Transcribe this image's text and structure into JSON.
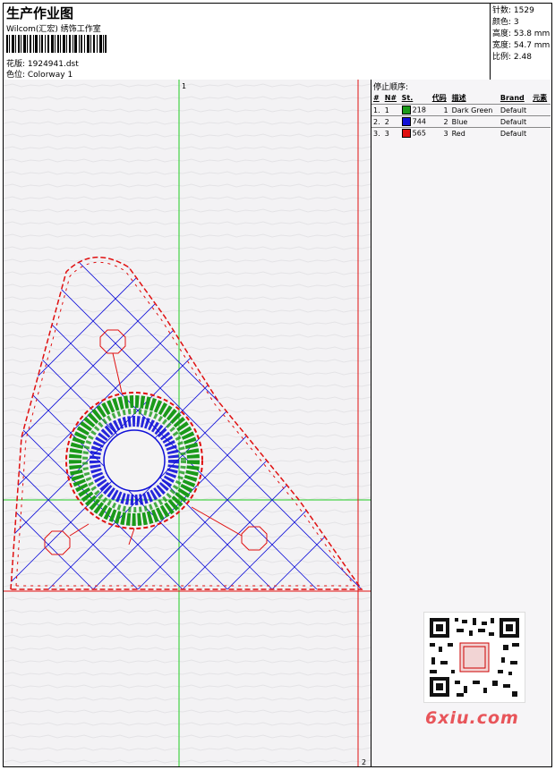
{
  "header": {
    "title": "生产作业图",
    "company": "Wilcom(汇宏) 绣饰工作室",
    "design_label": "花版: 1924941.dst",
    "colorway_label": "色位: Colorway 1"
  },
  "specs": {
    "stitches": "针数: 1529",
    "colors": "颜色: 3",
    "height": "高度: 53.8 mm",
    "width": "宽度: 54.7 mm",
    "scale": "比例: 2.48"
  },
  "guides": {
    "top_marker": "1",
    "bottom_marker": "2"
  },
  "thread_panel": {
    "title": "停止顺序:",
    "headers": [
      "#",
      "N#",
      "St.",
      "代码",
      "描述",
      "Brand",
      "元素"
    ],
    "rows": [
      {
        "num": "1.",
        "n": "1",
        "color": "#1a9a1a",
        "st": "218",
        "code": "1",
        "desc": "Dark Green",
        "brand": "Default"
      },
      {
        "num": "2.",
        "n": "2",
        "color": "#1010d8",
        "st": "744",
        "code": "2",
        "desc": "Blue",
        "brand": "Default"
      },
      {
        "num": "3.",
        "n": "3",
        "color": "#e01010",
        "st": "565",
        "code": "3",
        "desc": "Red",
        "brand": "Default"
      }
    ]
  },
  "watermark": {
    "logo_text": "6xiu.com"
  },
  "colors": {
    "guide": "#22cc22",
    "red": "#e01010",
    "blue": "#1010d8",
    "green": "#1a9a1a"
  }
}
